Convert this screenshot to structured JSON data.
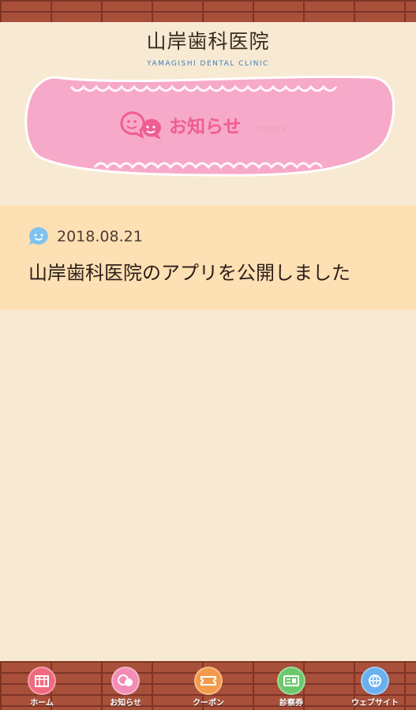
{
  "header": {
    "logo_jp": "山岸歯科医院",
    "logo_en": "YAMAGISHI DENTAL CLINIC"
  },
  "banner": {
    "title": "お知らせ",
    "subtitle": "TOPICS",
    "icon": "chat-bubbles-icon"
  },
  "news": [
    {
      "date": "2018.08.21",
      "title": "山岸歯科医院のアプリを公開しました",
      "icon": "smile-bubble-icon"
    }
  ],
  "tabbar": {
    "items": [
      {
        "label": "ホーム",
        "icon": "home-icon",
        "color": "#f06a7f"
      },
      {
        "label": "お知らせ",
        "icon": "chat-bubbles-icon",
        "color": "#f38db5"
      },
      {
        "label": "クーポン",
        "icon": "coupon-icon",
        "color": "#f39a4b"
      },
      {
        "label": "診察券",
        "icon": "card-icon",
        "color": "#6cc96b"
      },
      {
        "label": "ウェブサイト",
        "icon": "globe-icon",
        "color": "#6ab0ef"
      }
    ]
  },
  "colors": {
    "background": "#f8ead2",
    "news_background": "#fde0b3",
    "accent_pink": "#ef5d93",
    "brick": "#a9503a"
  }
}
